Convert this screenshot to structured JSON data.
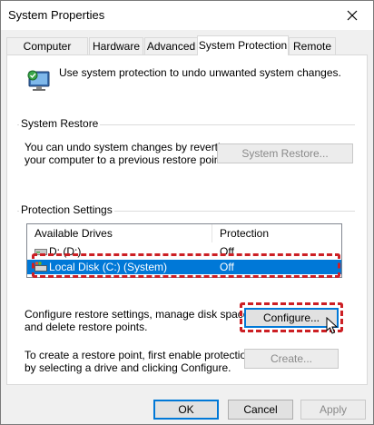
{
  "window": {
    "title": "System Properties"
  },
  "tabs": [
    {
      "label": "Computer Name"
    },
    {
      "label": "Hardware"
    },
    {
      "label": "Advanced"
    },
    {
      "label": "System Protection"
    },
    {
      "label": "Remote"
    }
  ],
  "active_tab": "System Protection",
  "intro": {
    "text": "Use system protection to undo unwanted system changes."
  },
  "system_restore": {
    "heading": "System Restore",
    "line1": "You can undo system changes by reverting",
    "line2": "your computer to a previous restore point.",
    "button": "System Restore..."
  },
  "protection": {
    "heading": "Protection Settings",
    "columns": [
      "Available Drives",
      "Protection"
    ],
    "drives": [
      {
        "name": "D: (D:)",
        "protection": "Off"
      },
      {
        "name": "Local Disk (C:) (System)",
        "protection": "Off",
        "selected": true
      }
    ],
    "configure_line1": "Configure restore settings, manage disk space,",
    "configure_line2": "and delete restore points.",
    "configure_button": "Configure...",
    "create_line1": "To create a restore point, first enable protection",
    "create_line2": "by selecting a drive and clicking Configure.",
    "create_button": "Create..."
  },
  "footer": {
    "ok": "OK",
    "cancel": "Cancel",
    "apply": "Apply"
  },
  "colors": {
    "accent": "#0078d7",
    "highlight": "#cc1f24"
  }
}
